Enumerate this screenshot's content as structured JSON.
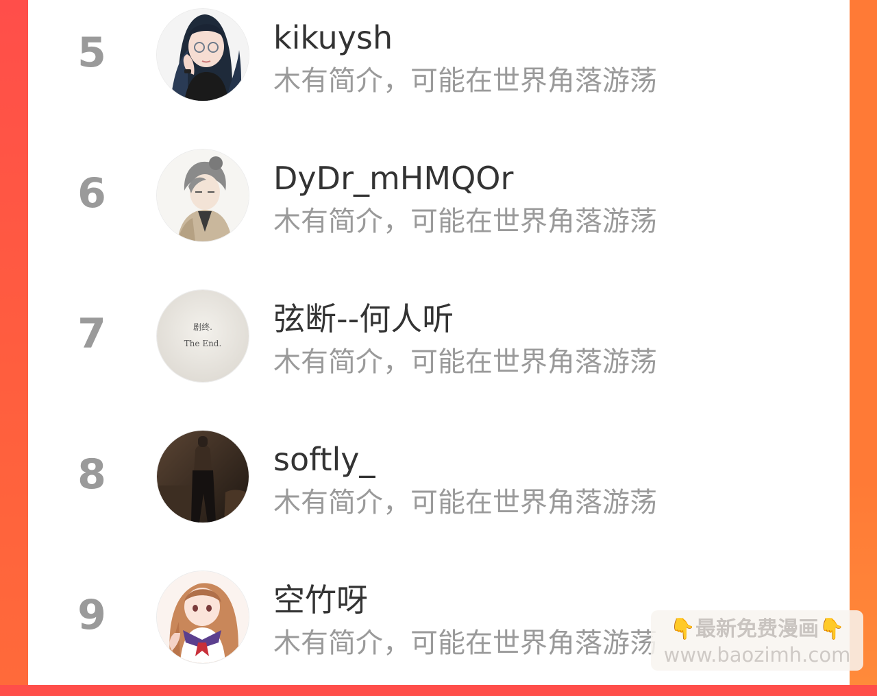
{
  "ranking": {
    "rows": [
      {
        "rank": "5",
        "name": "kikuysh",
        "bio": "木有简介，可能在世界角落游荡",
        "avatar_icon": "avatar-glasses-girl-icon"
      },
      {
        "rank": "6",
        "name": "DyDr_mHMQOr",
        "bio": "木有简介，可能在世界角落游荡",
        "avatar_icon": "avatar-grey-hair-boy-icon"
      },
      {
        "rank": "7",
        "name": "弦断--何人听",
        "bio": "木有简介，可能在世界角落游荡",
        "avatar_icon": "avatar-the-end-text-icon",
        "avatar_text": [
          "剧终.",
          "The End."
        ]
      },
      {
        "rank": "8",
        "name": "softly_",
        "bio": "木有简介，可能在世界角落游荡",
        "avatar_icon": "avatar-dark-room-figure-icon"
      },
      {
        "rank": "9",
        "name": "空竹呀",
        "bio": "木有简介，可能在世界角落游荡",
        "avatar_icon": "avatar-anime-sailor-girl-icon"
      }
    ]
  },
  "watermark": {
    "line1": "👇最新免费漫画👇",
    "line2": "www.baozimh.com"
  },
  "colors": {
    "left_background": "#ff4e4a",
    "right_background": "#ff7a36",
    "panel": "#ffffff",
    "rank_text": "#9a9a9a",
    "name_text": "#333333",
    "bio_text": "#9a9a9a"
  }
}
